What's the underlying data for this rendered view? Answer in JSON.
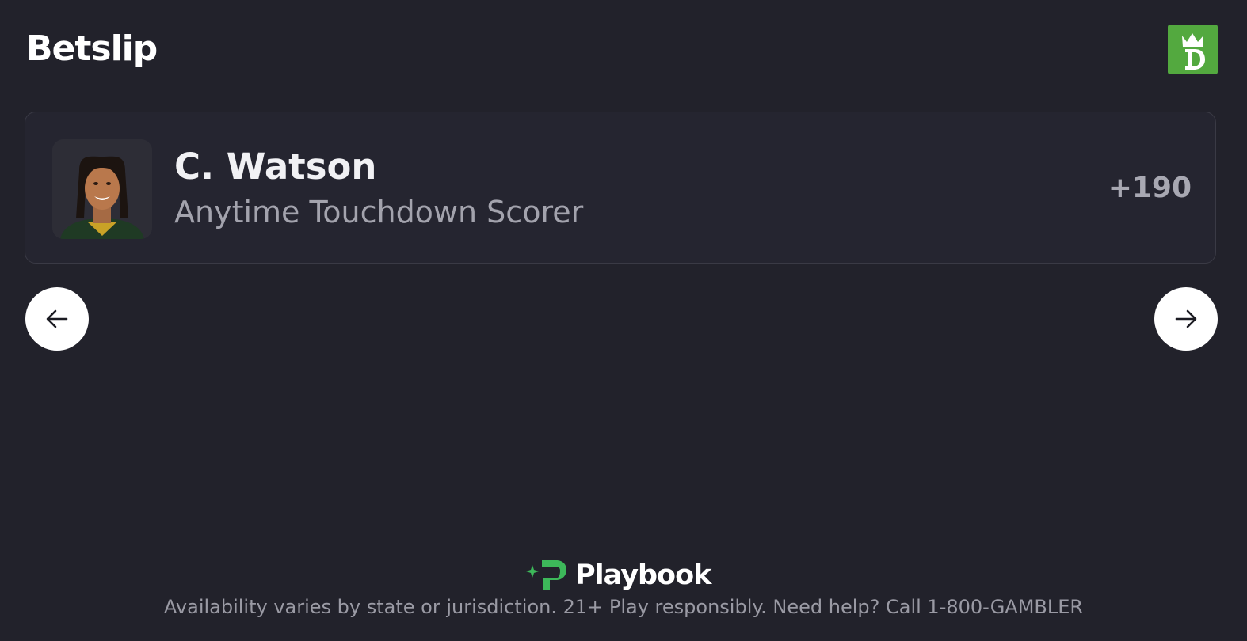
{
  "header": {
    "title": "Betslip",
    "brand_icon": "draftkings-crown-icon",
    "brand_color": "#53a93f"
  },
  "bet": {
    "player_name": "C. Watson",
    "market": "Anytime Touchdown Scorer",
    "odds": "+190",
    "avatar_icon": "player-headshot"
  },
  "navigation": {
    "prev_icon": "arrow-left-icon",
    "next_icon": "arrow-right-icon"
  },
  "footer": {
    "logo_text": "Playbook",
    "logo_color": "#3db85a",
    "disclaimer": "Availability varies by state or jurisdiction. 21+ Play responsibly. Need help? Call 1-800-GAMBLER"
  },
  "colors": {
    "background": "#22222b",
    "card": "#252530",
    "card_border": "#3a3a45"
  }
}
